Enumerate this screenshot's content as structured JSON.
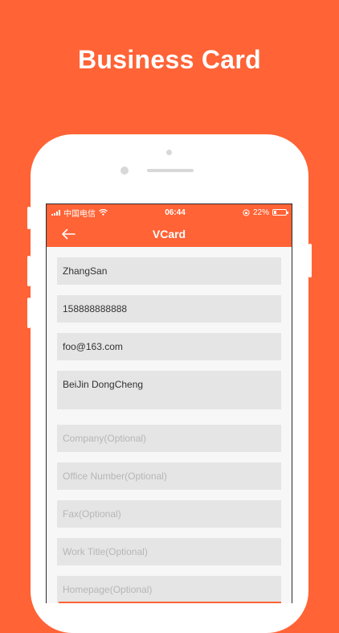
{
  "headline": "Business Card",
  "status_bar": {
    "carrier": "中国电信",
    "time": "06:44",
    "battery_percent": "22%",
    "battery_level": 0.22
  },
  "nav": {
    "title": "VCard",
    "back_icon": "arrow-left-icon"
  },
  "form": {
    "name": "ZhangSan",
    "phone": "158888888888",
    "email": "foo@163.com",
    "address": "BeiJin DongCheng",
    "company_placeholder": "Company(Optional)",
    "office_placeholder": "Office Number(Optional)",
    "fax_placeholder": "Fax(Optional)",
    "title_placeholder": "Work Title(Optional)",
    "homepage_placeholder": "Homepage(Optional)"
  },
  "colors": {
    "brand": "#FF6336",
    "field_bg": "#e5e5e5"
  }
}
